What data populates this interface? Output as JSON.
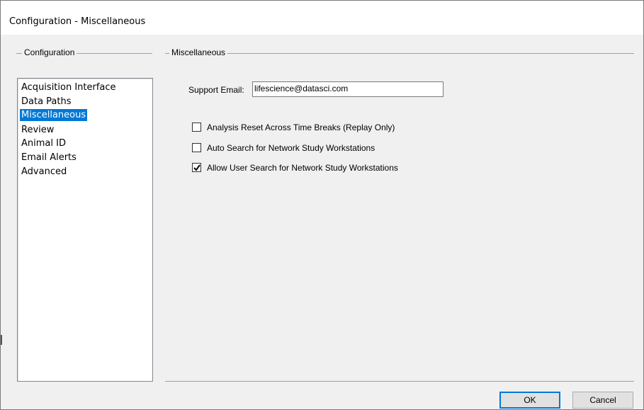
{
  "window": {
    "title": "Configuration - Miscellaneous"
  },
  "config_group": {
    "label": "Configuration",
    "items": [
      {
        "label": "Acquisition Interface",
        "selected": false
      },
      {
        "label": "Data Paths",
        "selected": false
      },
      {
        "label": "Miscellaneous",
        "selected": true
      },
      {
        "label": "Review",
        "selected": false
      },
      {
        "label": "Animal ID",
        "selected": false
      },
      {
        "label": "Email Alerts",
        "selected": false
      },
      {
        "label": "Advanced",
        "selected": false
      }
    ]
  },
  "misc_group": {
    "label": "Miscellaneous",
    "support_email_label": "Support Email:",
    "support_email_value": "lifescience@datasci.com",
    "options": [
      {
        "label": "Analysis Reset Across Time Breaks (Replay Only)",
        "checked": false
      },
      {
        "label": "Auto Search for Network Study Workstations",
        "checked": false
      },
      {
        "label": "Allow User Search for Network Study Workstations",
        "checked": true
      }
    ]
  },
  "buttons": {
    "ok_label": "OK",
    "cancel_label": "Cancel"
  },
  "colors": {
    "selection": "#0078d7",
    "background": "#f0f0f0"
  }
}
